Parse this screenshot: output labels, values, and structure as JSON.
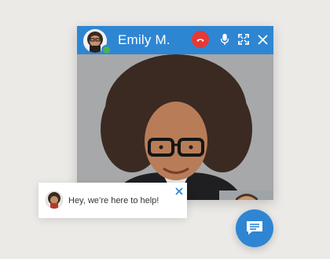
{
  "call": {
    "caller_name": "Emily M.",
    "status": "online",
    "icons": {
      "end_call": "end-call-icon",
      "mic": "microphone-icon",
      "fullscreen": "fullscreen-icon",
      "close": "close-icon"
    }
  },
  "chat": {
    "message": "Hey, we’re here to help!",
    "close_icon": "close-icon",
    "fab_icon": "chat-icon"
  },
  "colors": {
    "accent": "#2e86d3",
    "end_call": "#e53935",
    "presence": "#4caf50"
  }
}
